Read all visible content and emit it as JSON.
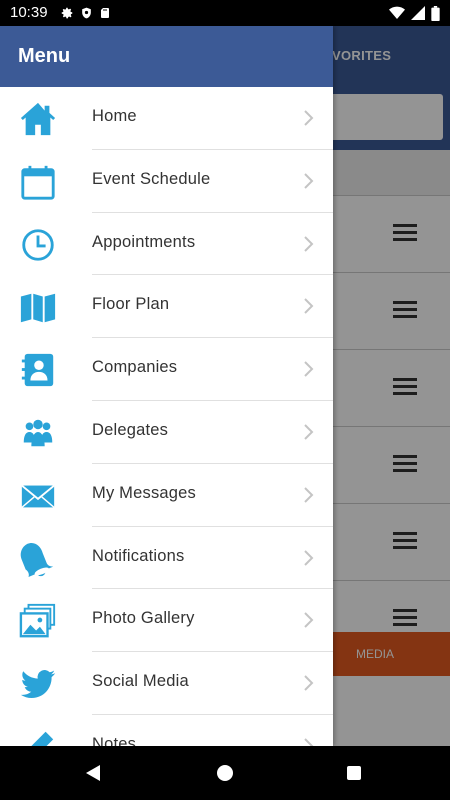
{
  "status_bar": {
    "time": "10:39",
    "left_icons": [
      "gear-icon",
      "shield-icon",
      "sd-card-icon"
    ],
    "right_icons": [
      "wifi-icon",
      "cellular-icon",
      "battery-icon"
    ]
  },
  "background": {
    "tab_label": "VORITES",
    "bottom_tab_label": "MEDIA",
    "row_count": 6
  },
  "drawer": {
    "title": "Menu",
    "items": [
      {
        "label": "Home",
        "icon": "home-icon"
      },
      {
        "label": "Event Schedule",
        "icon": "calendar-icon"
      },
      {
        "label": "Appointments",
        "icon": "clock-icon"
      },
      {
        "label": "Floor Plan",
        "icon": "map-icon"
      },
      {
        "label": "Companies",
        "icon": "contact-book-icon"
      },
      {
        "label": "Delegates",
        "icon": "people-icon"
      },
      {
        "label": "My Messages",
        "icon": "envelope-icon"
      },
      {
        "label": "Notifications",
        "icon": "bell-icon"
      },
      {
        "label": "Photo Gallery",
        "icon": "photo-gallery-icon"
      },
      {
        "label": "Social Media",
        "icon": "twitter-icon"
      },
      {
        "label": "Notes",
        "icon": "pencil-icon"
      }
    ]
  },
  "colors": {
    "header_blue": "#3c5a96",
    "icon_blue": "#2aa3d8",
    "accent_orange": "#e35a20"
  }
}
